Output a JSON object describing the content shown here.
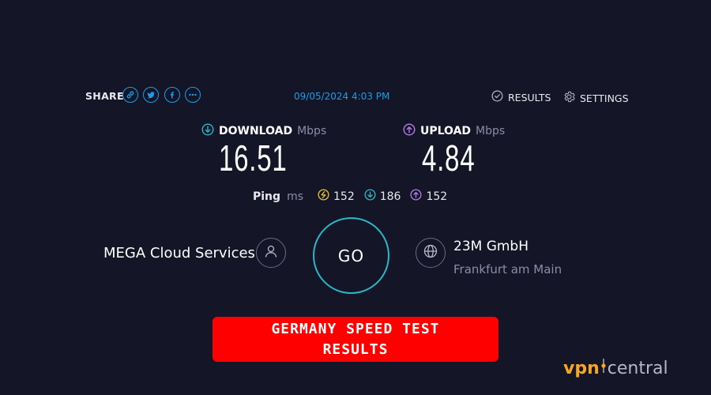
{
  "topbar": {
    "share_label": "SHARE",
    "share_icons": [
      "link-icon",
      "twitter-icon",
      "facebook-icon",
      "more-icon"
    ],
    "timestamp": "09/05/2024 4:03 PM",
    "results_label": "RESULTS",
    "settings_label": "SETTINGS"
  },
  "download": {
    "label": "DOWNLOAD",
    "unit": "Mbps",
    "value": "16.51"
  },
  "upload": {
    "label": "UPLOAD",
    "unit": "Mbps",
    "value": "4.84"
  },
  "ping": {
    "label": "Ping",
    "unit": "ms",
    "idle": "152",
    "download": "186",
    "upload": "152"
  },
  "provider": {
    "name": "MEGA Cloud Services",
    "icon": "person-icon"
  },
  "go_label": "GO",
  "server": {
    "name": "23M GmbH",
    "location": "Frankfurt am Main",
    "icon": "globe-icon"
  },
  "banner": {
    "line1": "GERMANY SPEED TEST",
    "line2": "RESULTS"
  },
  "watermark": {
    "vpn": "vpn",
    "central": "central"
  },
  "colors": {
    "background": "#141526",
    "accent_blue": "#1c9ce7",
    "download_teal": "#2ab7c8",
    "upload_purple": "#b27ee6",
    "ping_yellow": "#e5c33b",
    "banner_red": "#ff0000",
    "brand_orange": "#f5a623"
  }
}
